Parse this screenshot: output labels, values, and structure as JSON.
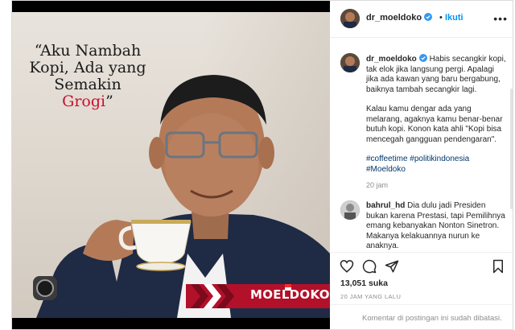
{
  "post": {
    "username": "dr_moeldoko",
    "verified": true,
    "separator": "•",
    "follow_label": "Ikuti",
    "more_label": "•••"
  },
  "image": {
    "quote_lines": [
      "“Aku Nambah",
      "Kopi, Ada yang",
      "Semakin"
    ],
    "quote_accent": "Grogi",
    "quote_close": "”",
    "brand": "MOELDOKO"
  },
  "caption": {
    "username": "dr_moeldoko",
    "paragraphs": [
      "Habis secangkir kopi, tak elok jika langsung pergi. Apalagi jika ada kawan yang baru bergabung, baiknya tambah secangkir lagi.",
      "Kalau kamu dengar ada yang melarang, agaknya kamu benar-benar butuh kopi. Konon kata ahli \"Kopi bisa mencegah gangguan pendengaran\"."
    ],
    "hashtags": "#coffeetime #politikindonesia #Moeldoko",
    "time": "20 jam"
  },
  "comment": {
    "username": "bahrul_hd",
    "text": "Dia dulu jadi Presiden bukan karena Prestasi, tapi Pemilihnya emang kebanyakan Nonton Sinetron. Makanya kelakuannya nurun ke anaknya."
  },
  "stats": {
    "likes": "13,051 suka",
    "posted": "20 JAM YANG LALU"
  },
  "footer": {
    "comments_closed": "Komentar di postingan ini sudah dibatasi."
  },
  "colors": {
    "accent_red": "#c8102e",
    "link_blue": "#0095f6",
    "brand_bar": "#b3102a"
  },
  "icons": [
    "verified-badge-icon",
    "more-options-icon",
    "like-icon",
    "comment-icon",
    "share-icon",
    "save-icon"
  ]
}
